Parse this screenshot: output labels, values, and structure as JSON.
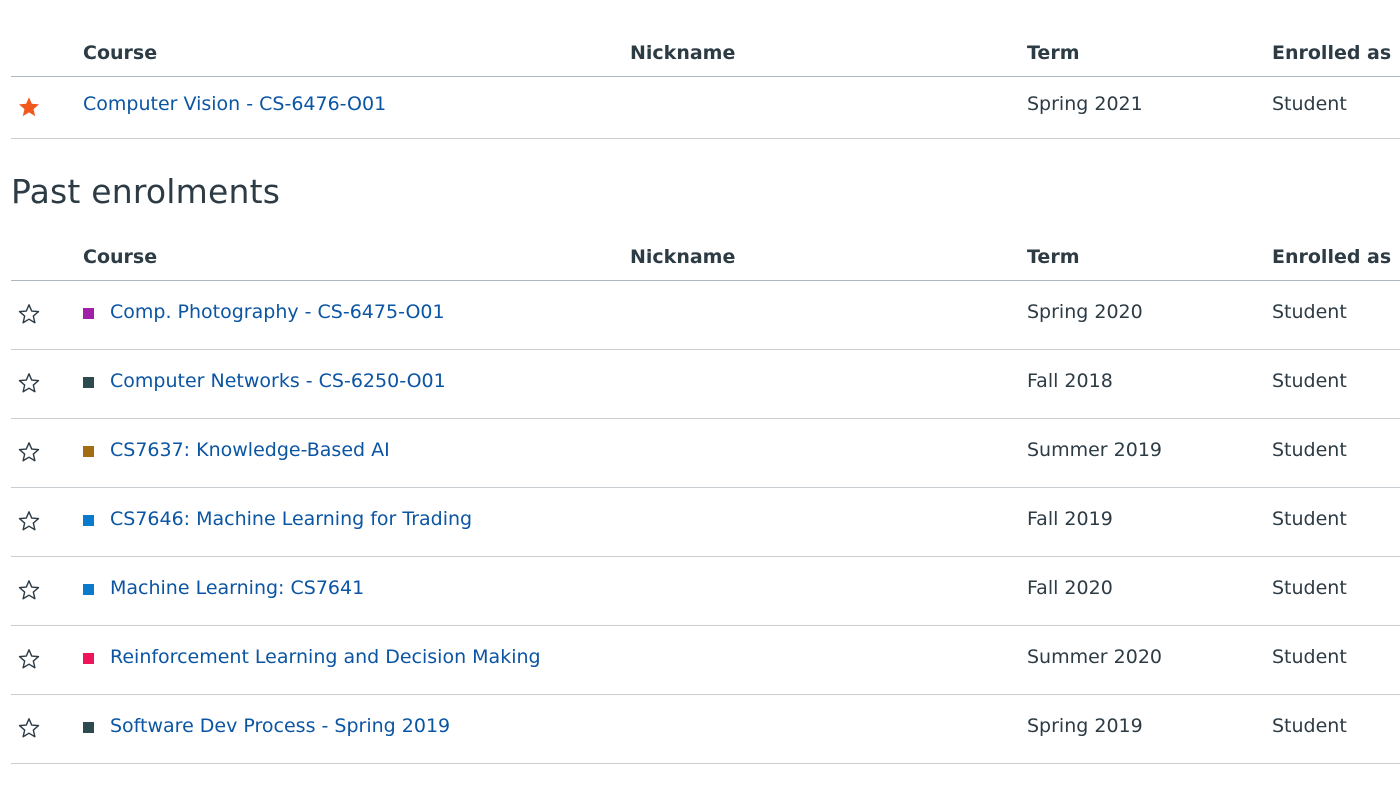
{
  "current": {
    "headers": {
      "course": "Course",
      "nickname": "Nickname",
      "term": "Term",
      "enrolled": "Enrolled as"
    },
    "rows": [
      {
        "favorite": true,
        "star_icon": "star-filled-icon",
        "course": "Computer Vision - CS-6476-O01",
        "color": null,
        "nickname": "",
        "term": "Spring 2021",
        "enrolled": "Student"
      }
    ]
  },
  "past": {
    "title": "Past enrolments",
    "headers": {
      "course": "Course",
      "nickname": "Nickname",
      "term": "Term",
      "enrolled": "Enrolled as"
    },
    "rows": [
      {
        "favorite": false,
        "star_icon": "star-outline-icon",
        "course": "Comp. Photography - CS-6475-O01",
        "color": "#a020a8",
        "nickname": "",
        "term": "Spring 2020",
        "enrolled": "Student"
      },
      {
        "favorite": false,
        "star_icon": "star-outline-icon",
        "course": "Computer Networks - CS-6250-O01",
        "color": "#2d4a4e",
        "nickname": "",
        "term": "Fall 2018",
        "enrolled": "Student"
      },
      {
        "favorite": false,
        "star_icon": "star-outline-icon",
        "course": "CS7637: Knowledge-Based AI",
        "color": "#a36e12",
        "nickname": "",
        "term": "Summer 2019",
        "enrolled": "Student"
      },
      {
        "favorite": false,
        "star_icon": "star-outline-icon",
        "course": "CS7646: Machine Learning for Trading",
        "color": "#0a7acc",
        "nickname": "",
        "term": "Fall 2019",
        "enrolled": "Student"
      },
      {
        "favorite": false,
        "star_icon": "star-outline-icon",
        "course": "Machine Learning: CS7641",
        "color": "#0a7acc",
        "nickname": "",
        "term": "Fall 2020",
        "enrolled": "Student"
      },
      {
        "favorite": false,
        "star_icon": "star-outline-icon",
        "course": "Reinforcement Learning and Decision Making",
        "color": "#f0145a",
        "nickname": "",
        "term": "Summer 2020",
        "enrolled": "Student"
      },
      {
        "favorite": false,
        "star_icon": "star-outline-icon",
        "course": "Software Dev Process - Spring 2019",
        "color": "#2d4a4e",
        "nickname": "",
        "term": "Spring 2019",
        "enrolled": "Student"
      }
    ]
  },
  "colors": {
    "link": "#0b55a3",
    "text": "#2d3b45",
    "favorite_star": "#f2571c",
    "border": "#c7cdd1"
  }
}
